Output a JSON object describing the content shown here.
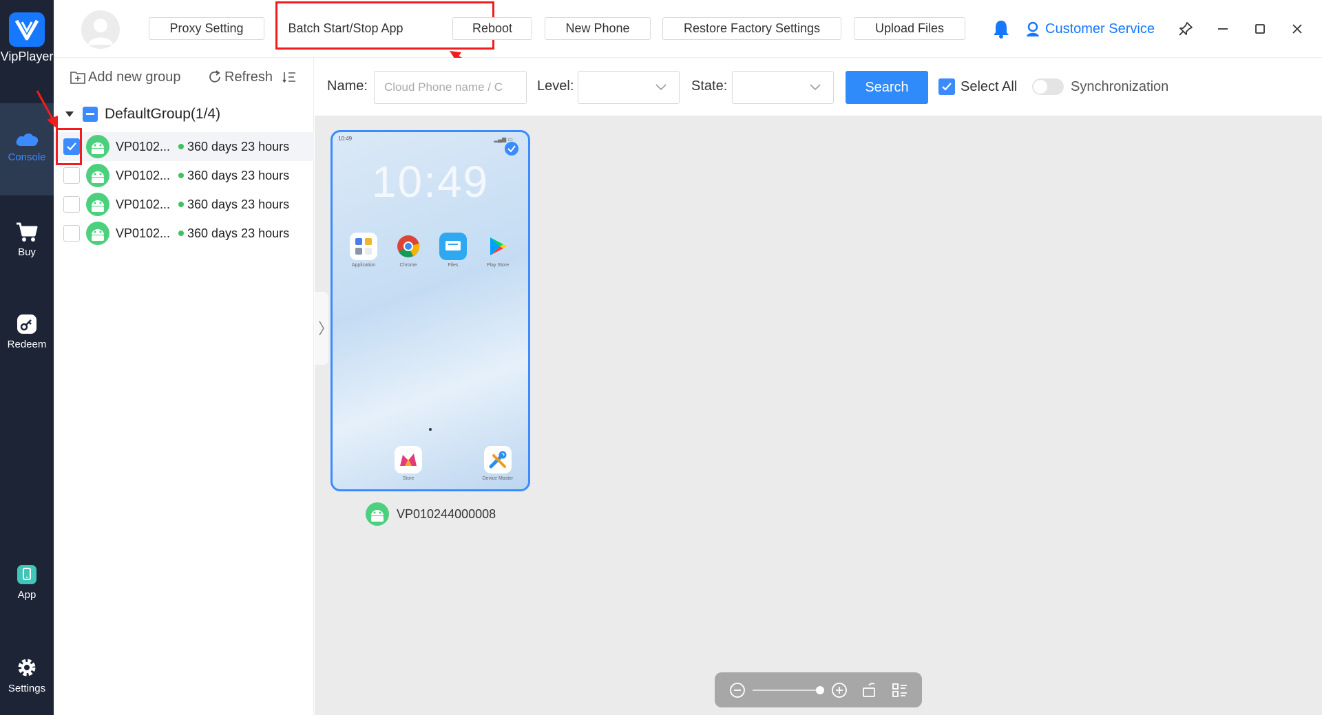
{
  "app": {
    "name": "VipPlayer",
    "brand_color": "#1677ff",
    "highlight_color": "#f21c1c"
  },
  "nav": {
    "items": [
      {
        "label": "Console",
        "icon": "cloud-icon",
        "active": true
      },
      {
        "label": "Buy",
        "icon": "cart-icon",
        "active": false
      },
      {
        "label": "Redeem",
        "icon": "key-icon",
        "active": false
      },
      {
        "label": "App",
        "icon": "phone-app-icon",
        "active": false
      },
      {
        "label": "Settings",
        "icon": "gear-icon",
        "active": false
      }
    ]
  },
  "toolbar": {
    "buttons": [
      {
        "label": "Proxy Setting"
      },
      {
        "label": "Batch Start/Stop App"
      },
      {
        "label": "Reboot"
      },
      {
        "label": "New Phone"
      },
      {
        "label": "Restore Factory Settings"
      },
      {
        "label": "Upload Files"
      }
    ],
    "customer_service": "Customer Service"
  },
  "sidebar": {
    "add_group": "Add new group",
    "refresh": "Refresh",
    "group": {
      "label": "DefaultGroup(1/4)",
      "expanded": true
    },
    "devices": [
      {
        "name": "VP0102...",
        "remaining": "360 days 23 hours",
        "checked": true,
        "status": "online"
      },
      {
        "name": "VP0102...",
        "remaining": "360 days 23 hours",
        "checked": false,
        "status": "online"
      },
      {
        "name": "VP0102...",
        "remaining": "360 days 23 hours",
        "checked": false,
        "status": "online"
      },
      {
        "name": "VP0102...",
        "remaining": "360 days 23 hours",
        "checked": false,
        "status": "online"
      }
    ]
  },
  "filters": {
    "name_label": "Name:",
    "name_placeholder": "Cloud Phone name / C",
    "level_label": "Level:",
    "level_value": "",
    "state_label": "State:",
    "state_value": "",
    "search_button": "Search",
    "select_all": "Select All",
    "select_all_checked": true,
    "synchronization": "Synchronization",
    "synchronization_on": false
  },
  "phone_card": {
    "status_time": "10:49",
    "clock": "10:49",
    "apps": [
      {
        "label": "Application",
        "icon": "folder-icon"
      },
      {
        "label": "Chrome",
        "icon": "chrome-icon"
      },
      {
        "label": "Files",
        "icon": "files-icon"
      },
      {
        "label": "Play Store",
        "icon": "play-store-icon"
      }
    ],
    "dock": [
      {
        "label": "Store",
        "icon": "store-icon"
      },
      {
        "label": "Device Master",
        "icon": "tools-icon"
      }
    ],
    "device_id": "VP010244000008",
    "selected": true
  }
}
